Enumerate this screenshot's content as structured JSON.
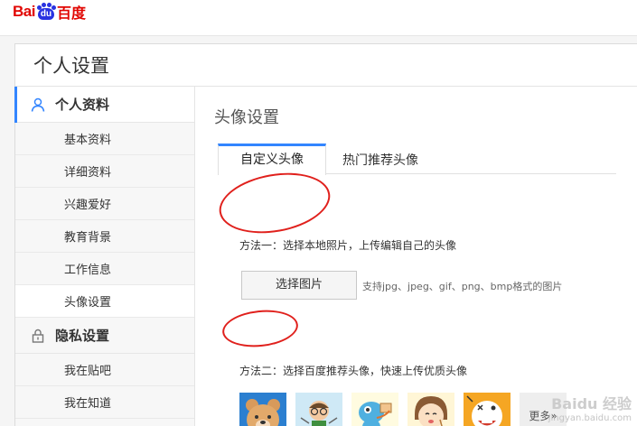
{
  "brand": {
    "logo_left": "Bai",
    "logo_paw": "du",
    "logo_right": "百度",
    "color": "#e10602",
    "paw_color": "#2932e1"
  },
  "page": {
    "title": "个人设置"
  },
  "sidebar": {
    "profile": {
      "label": "个人资料",
      "icon": "user-icon"
    },
    "profile_items": [
      {
        "label": "基本资料"
      },
      {
        "label": "详细资料"
      },
      {
        "label": "兴趣爱好"
      },
      {
        "label": "教育背景"
      },
      {
        "label": "工作信息"
      },
      {
        "label": "头像设置",
        "current": true
      }
    ],
    "privacy": {
      "label": "隐私设置",
      "icon": "lock-icon"
    },
    "privacy_items": [
      {
        "label": "我在贴吧"
      },
      {
        "label": "我在知道"
      }
    ],
    "accent": "#3385ff"
  },
  "content": {
    "title": "头像设置",
    "tabs": [
      {
        "label": "自定义头像",
        "active": true
      },
      {
        "label": "热门推荐头像",
        "active": false
      }
    ],
    "method1": "方法一：选择本地照片，上传编辑自己的头像",
    "pick_button": "选择图片",
    "support_text": "支持jpg、jpeg、gif、png、bmp格式的图片",
    "method2": "方法二：选择百度推荐头像，快速上传优质头像",
    "avatars": [
      {
        "icon": "bear-avatar-icon"
      },
      {
        "icon": "glasses-boy-avatar-icon"
      },
      {
        "icon": "blue-creature-avatar-icon"
      },
      {
        "icon": "girl-eating-avatar-icon"
      },
      {
        "icon": "orange-face-avatar-icon"
      }
    ],
    "more_label": "更多»",
    "annotation_color": "#e0201c"
  },
  "watermark": {
    "main": "Baidu 经验",
    "sub": "jingyan.baidu.com"
  }
}
